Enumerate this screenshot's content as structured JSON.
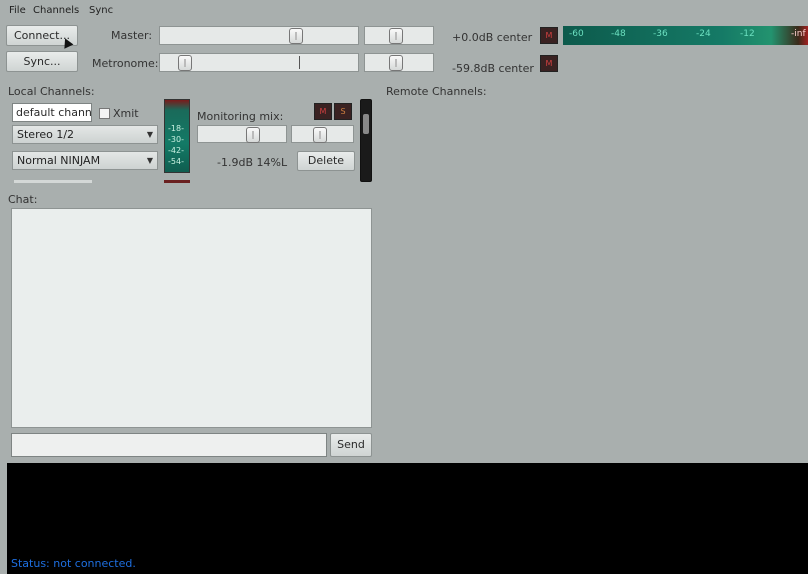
{
  "menu": [
    "File",
    "Channels",
    "Sync"
  ],
  "buttons": {
    "connect": "Connect...",
    "sync": "Sync...",
    "delete": "Delete",
    "send": "Send"
  },
  "master": {
    "label": "Master:",
    "readout": "+0.0dB center",
    "volume_fraction": 0.7,
    "pan_fraction": 0.45,
    "mute_label": "M"
  },
  "metronome": {
    "label": "Metronome:",
    "readout": "-59.8dB center",
    "volume_fraction": 0.1,
    "pan_fraction": 0.45,
    "mute_label": "M"
  },
  "vu_meter": {
    "ticks": [
      "-60",
      "-48",
      "-36",
      "-24",
      "-12",
      "-inf"
    ]
  },
  "local_channels": {
    "heading": "Local Channels:",
    "channel_name": "default channel",
    "transmit_label": "Xmit",
    "transmit_checked": false,
    "input_select": "Stereo 1/2",
    "mode_select": "Normal NINJAM",
    "meter_ticks": [
      "-18-",
      "-30-",
      "-42-",
      "-54-"
    ],
    "monitoring_label": "Monitoring mix:",
    "monitor_volume_fraction": 0.65,
    "monitor_pan_fraction": 0.45,
    "readout": "-1.9dB 14%L",
    "mute_label": "M",
    "solo_label": "S"
  },
  "remote_channels": {
    "heading": "Remote Channels:"
  },
  "chat": {
    "label": "Chat:",
    "input_value": ""
  },
  "status": {
    "text": "Status: not connected."
  },
  "colors": {
    "background": "#a9afae",
    "status_text": "#1e6fe0",
    "vu_green": "#157a66",
    "mute_red": "#d04040"
  }
}
